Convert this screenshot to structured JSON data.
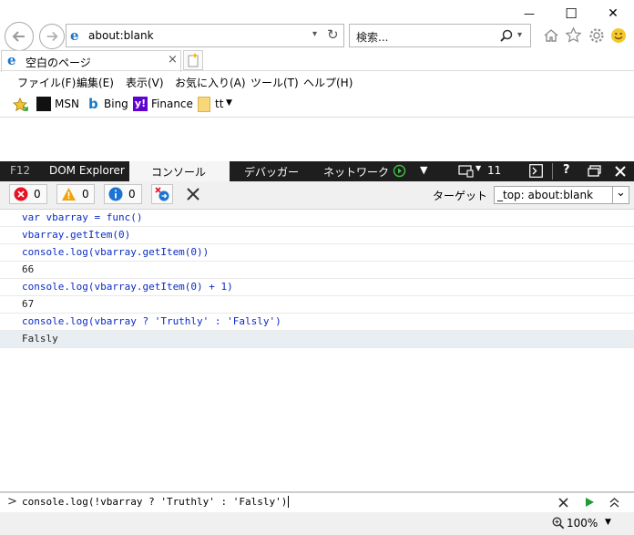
{
  "window_controls": {
    "minimize": "—",
    "maximize": "☐",
    "close": "✕"
  },
  "navigation": {
    "back_icon": "back-arrow-icon",
    "forward_icon": "forward-arrow-icon",
    "address": "about:blank",
    "search_placeholder": "検索...",
    "toolbar_icons": [
      "home-icon",
      "star-icon",
      "gear-icon",
      "smiley-icon"
    ]
  },
  "tab": {
    "title": "空白のページ",
    "close": "×"
  },
  "menu": [
    "ファイル(F)",
    "編集(E)",
    "表示(V)",
    "お気に入り(A)",
    "ツール(T)",
    "ヘルプ(H)"
  ],
  "favorites": [
    {
      "label": "MSN"
    },
    {
      "label": "Bing"
    },
    {
      "label": "Finance"
    },
    {
      "label": "tt"
    }
  ],
  "devtools": {
    "tabs": {
      "f12": "F12",
      "dom": "DOM Explorer",
      "console": "コンソール",
      "debugger": "デバッガー",
      "network": "ネットワーク",
      "emulation_count": "11"
    },
    "colors": {
      "bar": "#1e1e1e",
      "active": "#f5f5f5",
      "input_text": "#0b2bc4"
    }
  },
  "console_toolbar": {
    "errors": "0",
    "warnings": "0",
    "info": "0",
    "target_label": "ターゲット",
    "target_value": "_top: about:blank"
  },
  "console_lines": [
    {
      "type": "input",
      "text": "var vbarray = func()"
    },
    {
      "type": "input",
      "text": "vbarray.getItem(0)"
    },
    {
      "type": "input",
      "text": "console.log(vbarray.getItem(0))"
    },
    {
      "type": "result",
      "text": "66"
    },
    {
      "type": "input",
      "text": "console.log(vbarray.getItem(0) + 1)"
    },
    {
      "type": "result",
      "text": "67"
    },
    {
      "type": "input",
      "text": "console.log(vbarray ? 'Truthly' : 'Falsly')"
    },
    {
      "type": "result",
      "text": "Falsly"
    }
  ],
  "console_input": {
    "prompt": ">",
    "value": "console.log(!vbarray ? 'Truthly' : 'Falsly')"
  },
  "status": {
    "zoom": "100%"
  }
}
